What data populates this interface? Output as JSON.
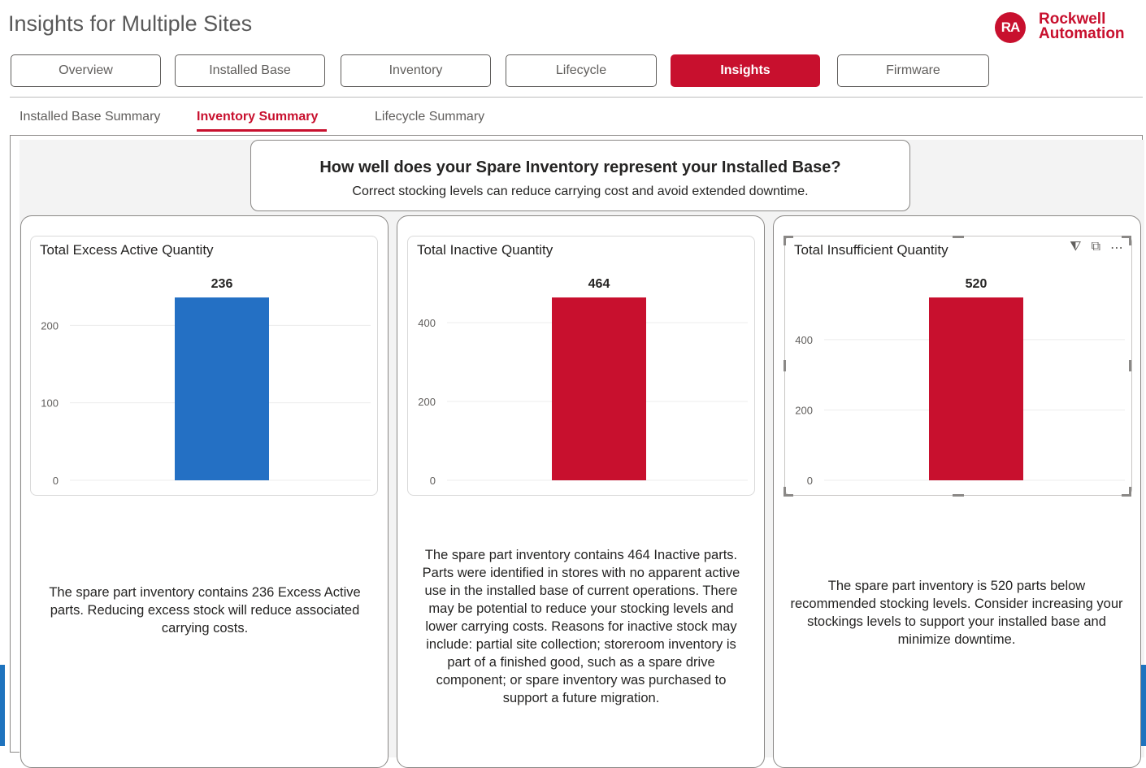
{
  "header": {
    "title": "Insights for Multiple Sites",
    "logo": {
      "badge": "RA",
      "line1": "Rockwell",
      "line2": "Automation",
      "color": "#c8102e"
    }
  },
  "nav": {
    "buttons": [
      "Overview",
      "Installed Base",
      "Inventory",
      "Lifecycle",
      "Insights",
      "Firmware"
    ],
    "active": "Insights"
  },
  "subtabs": {
    "items": [
      "Installed Base Summary",
      "Inventory Summary",
      "Lifecycle Summary"
    ],
    "active": "Inventory Summary"
  },
  "question": {
    "title": "How well does your Spare Inventory represent your Installed Base?",
    "subtitle": "Correct stocking levels can reduce carrying cost and avoid extended downtime."
  },
  "visual_header_icons": [
    "filter-icon",
    "focus-mode-icon",
    "more-options-icon"
  ],
  "colors": {
    "accent": "#c8102e",
    "blue_bar": "#2470c4",
    "red_bar": "#c8102e"
  },
  "chart_data": [
    {
      "type": "bar",
      "title": "Total Excess Active Quantity",
      "categories": [
        ""
      ],
      "values": [
        236
      ],
      "data_label": "236",
      "color": "#2470c4",
      "yticks": [
        0,
        100,
        200
      ],
      "ylim": [
        0,
        236
      ],
      "grid": true
    },
    {
      "type": "bar",
      "title": "Total Inactive Quantity",
      "categories": [
        ""
      ],
      "values": [
        464
      ],
      "data_label": "464",
      "color": "#c8102e",
      "yticks": [
        0,
        200,
        400
      ],
      "ylim": [
        0,
        464
      ],
      "grid": true
    },
    {
      "type": "bar",
      "title": "Total Insufficient Quantity",
      "categories": [
        ""
      ],
      "values": [
        520
      ],
      "data_label": "520",
      "color": "#c8102e",
      "yticks": [
        0,
        200,
        400
      ],
      "ylim": [
        0,
        520
      ],
      "grid": true
    }
  ],
  "descriptions": [
    "The spare part inventory contains 236 Excess Active parts.  Reducing excess stock will reduce associated carrying costs.",
    "The spare part inventory contains 464 Inactive parts.  Parts were identified in stores with no apparent active use in the installed base of current operations.  There may be potential to reduce your stocking levels and lower carrying costs.  Reasons for inactive stock may include: partial site collection; storeroom inventory is part of a finished good, such as a spare drive component; or spare inventory was purchased to support a future migration.",
    "The spare part inventory is 520 parts below recommended stocking levels. Consider increasing your stockings levels to support your installed base and minimize downtime."
  ]
}
